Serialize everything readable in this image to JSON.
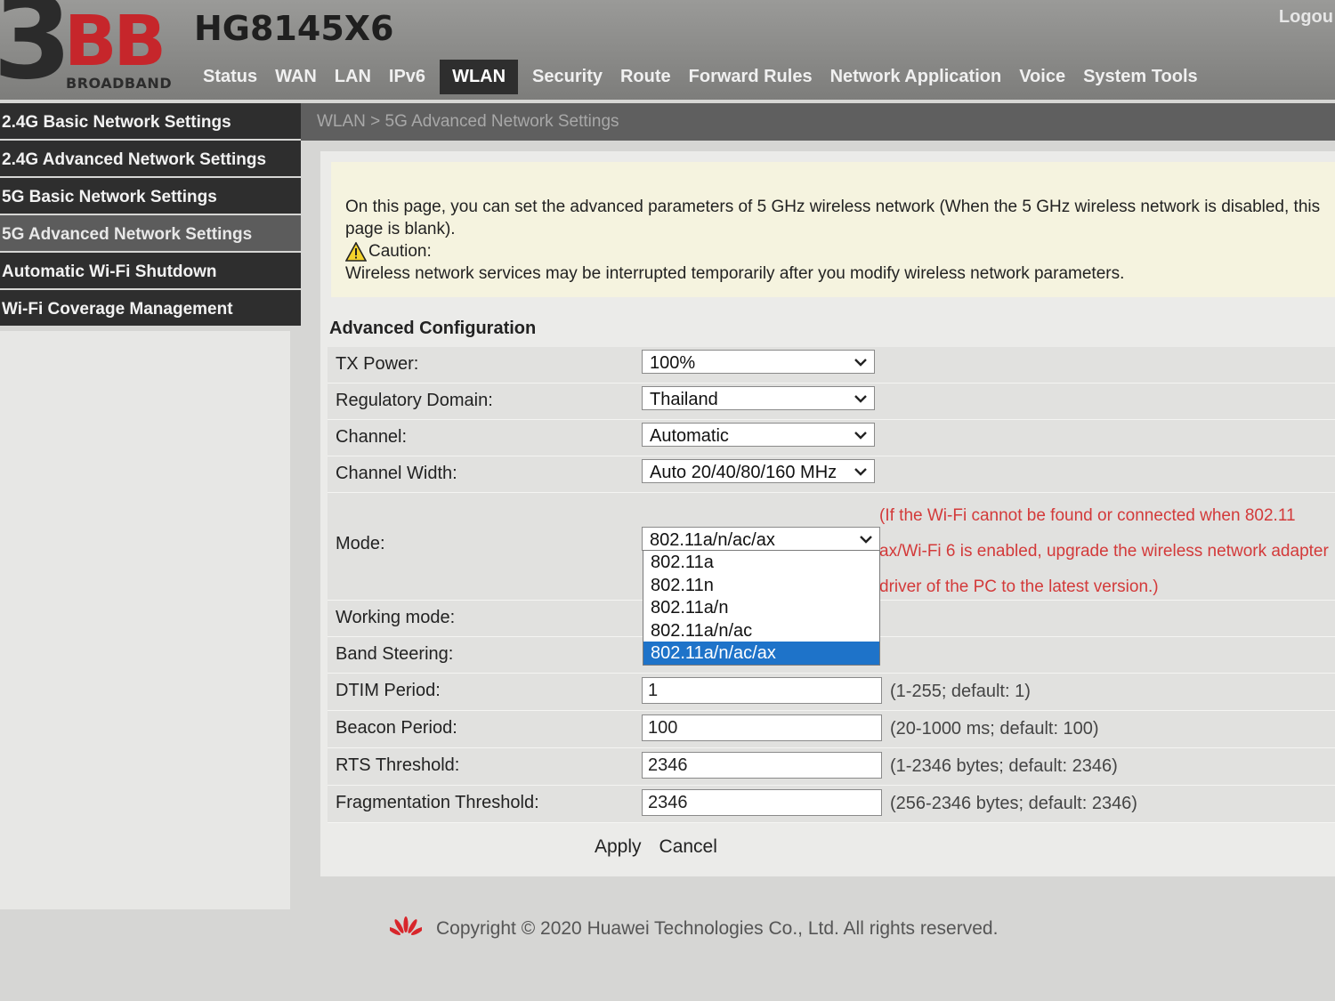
{
  "header": {
    "logo_number": "3",
    "logo_letters": "BB",
    "logo_sub": "BROADBAND",
    "device_title": "HG8145X6",
    "logout_label": "Logou",
    "nav": [
      {
        "label": "Status"
      },
      {
        "label": "WAN"
      },
      {
        "label": "LAN"
      },
      {
        "label": "IPv6"
      },
      {
        "label": "WLAN"
      },
      {
        "label": "Security"
      },
      {
        "label": "Route"
      },
      {
        "label": "Forward Rules"
      },
      {
        "label": "Network Application"
      },
      {
        "label": "Voice"
      },
      {
        "label": "System Tools"
      }
    ],
    "active_nav": "WLAN"
  },
  "sidebar": {
    "items": [
      {
        "label": "2.4G Basic Network Settings"
      },
      {
        "label": "2.4G Advanced Network Settings"
      },
      {
        "label": "5G Basic Network Settings"
      },
      {
        "label": "5G Advanced Network Settings"
      },
      {
        "label": "Automatic Wi-Fi Shutdown"
      },
      {
        "label": "Wi-Fi Coverage Management"
      }
    ],
    "active_item": "5G Advanced Network Settings"
  },
  "breadcrumb": "WLAN > 5G Advanced Network Settings",
  "notice": {
    "text": "On this page, you can set the advanced parameters of 5 GHz wireless network (When the 5 GHz wireless network is disabled, this page is blank).",
    "caution_label": "Caution:",
    "caution_text": "Wireless network services may be interrupted temporarily after you modify wireless network parameters."
  },
  "section_title": "Advanced Configuration",
  "form": {
    "tx_power": {
      "label": "TX Power:",
      "value": "100%"
    },
    "regulatory_domain": {
      "label": "Regulatory Domain:",
      "value": "Thailand"
    },
    "channel": {
      "label": "Channel:",
      "value": "Automatic"
    },
    "channel_width": {
      "label": "Channel Width:",
      "value": "Auto 20/40/80/160 MHz"
    },
    "mode": {
      "label": "Mode:",
      "value": "802.11a/n/ac/ax",
      "note": "(If the Wi-Fi cannot be found or connected when 802.11 ax/Wi-Fi 6 is enabled, upgrade the wireless network adapter driver of the PC to the latest version.)",
      "options": [
        "802.11a",
        "802.11n",
        "802.11a/n",
        "802.11a/n/ac",
        "802.11a/n/ac/ax"
      ]
    },
    "working_mode": {
      "label": "Working mode:"
    },
    "band_steering": {
      "label": "Band Steering:"
    },
    "dtim_period": {
      "label": "DTIM Period:",
      "value": "1",
      "hint": "(1-255; default: 1)"
    },
    "beacon_period": {
      "label": "Beacon Period:",
      "value": "100",
      "hint": "(20-1000 ms; default: 100)"
    },
    "rts_threshold": {
      "label": "RTS Threshold:",
      "value": "2346",
      "hint": "(1-2346 bytes; default: 2346)"
    },
    "fragmentation_threshold": {
      "label": "Fragmentation Threshold:",
      "value": "2346",
      "hint": "(256-2346 bytes; default: 2346)"
    }
  },
  "buttons": {
    "apply": "Apply",
    "cancel": "Cancel"
  },
  "footer": {
    "copyright": "Copyright © 2020 Huawei Technologies Co., Ltd. All rights reserved."
  },
  "colors": {
    "accent_red": "#c6262b",
    "selected_blue": "#1e73c9",
    "note_red": "#d33a3a"
  },
  "icons": [
    "chevron-down-icon",
    "warning-triangle-icon",
    "huawei-logo-icon"
  ]
}
